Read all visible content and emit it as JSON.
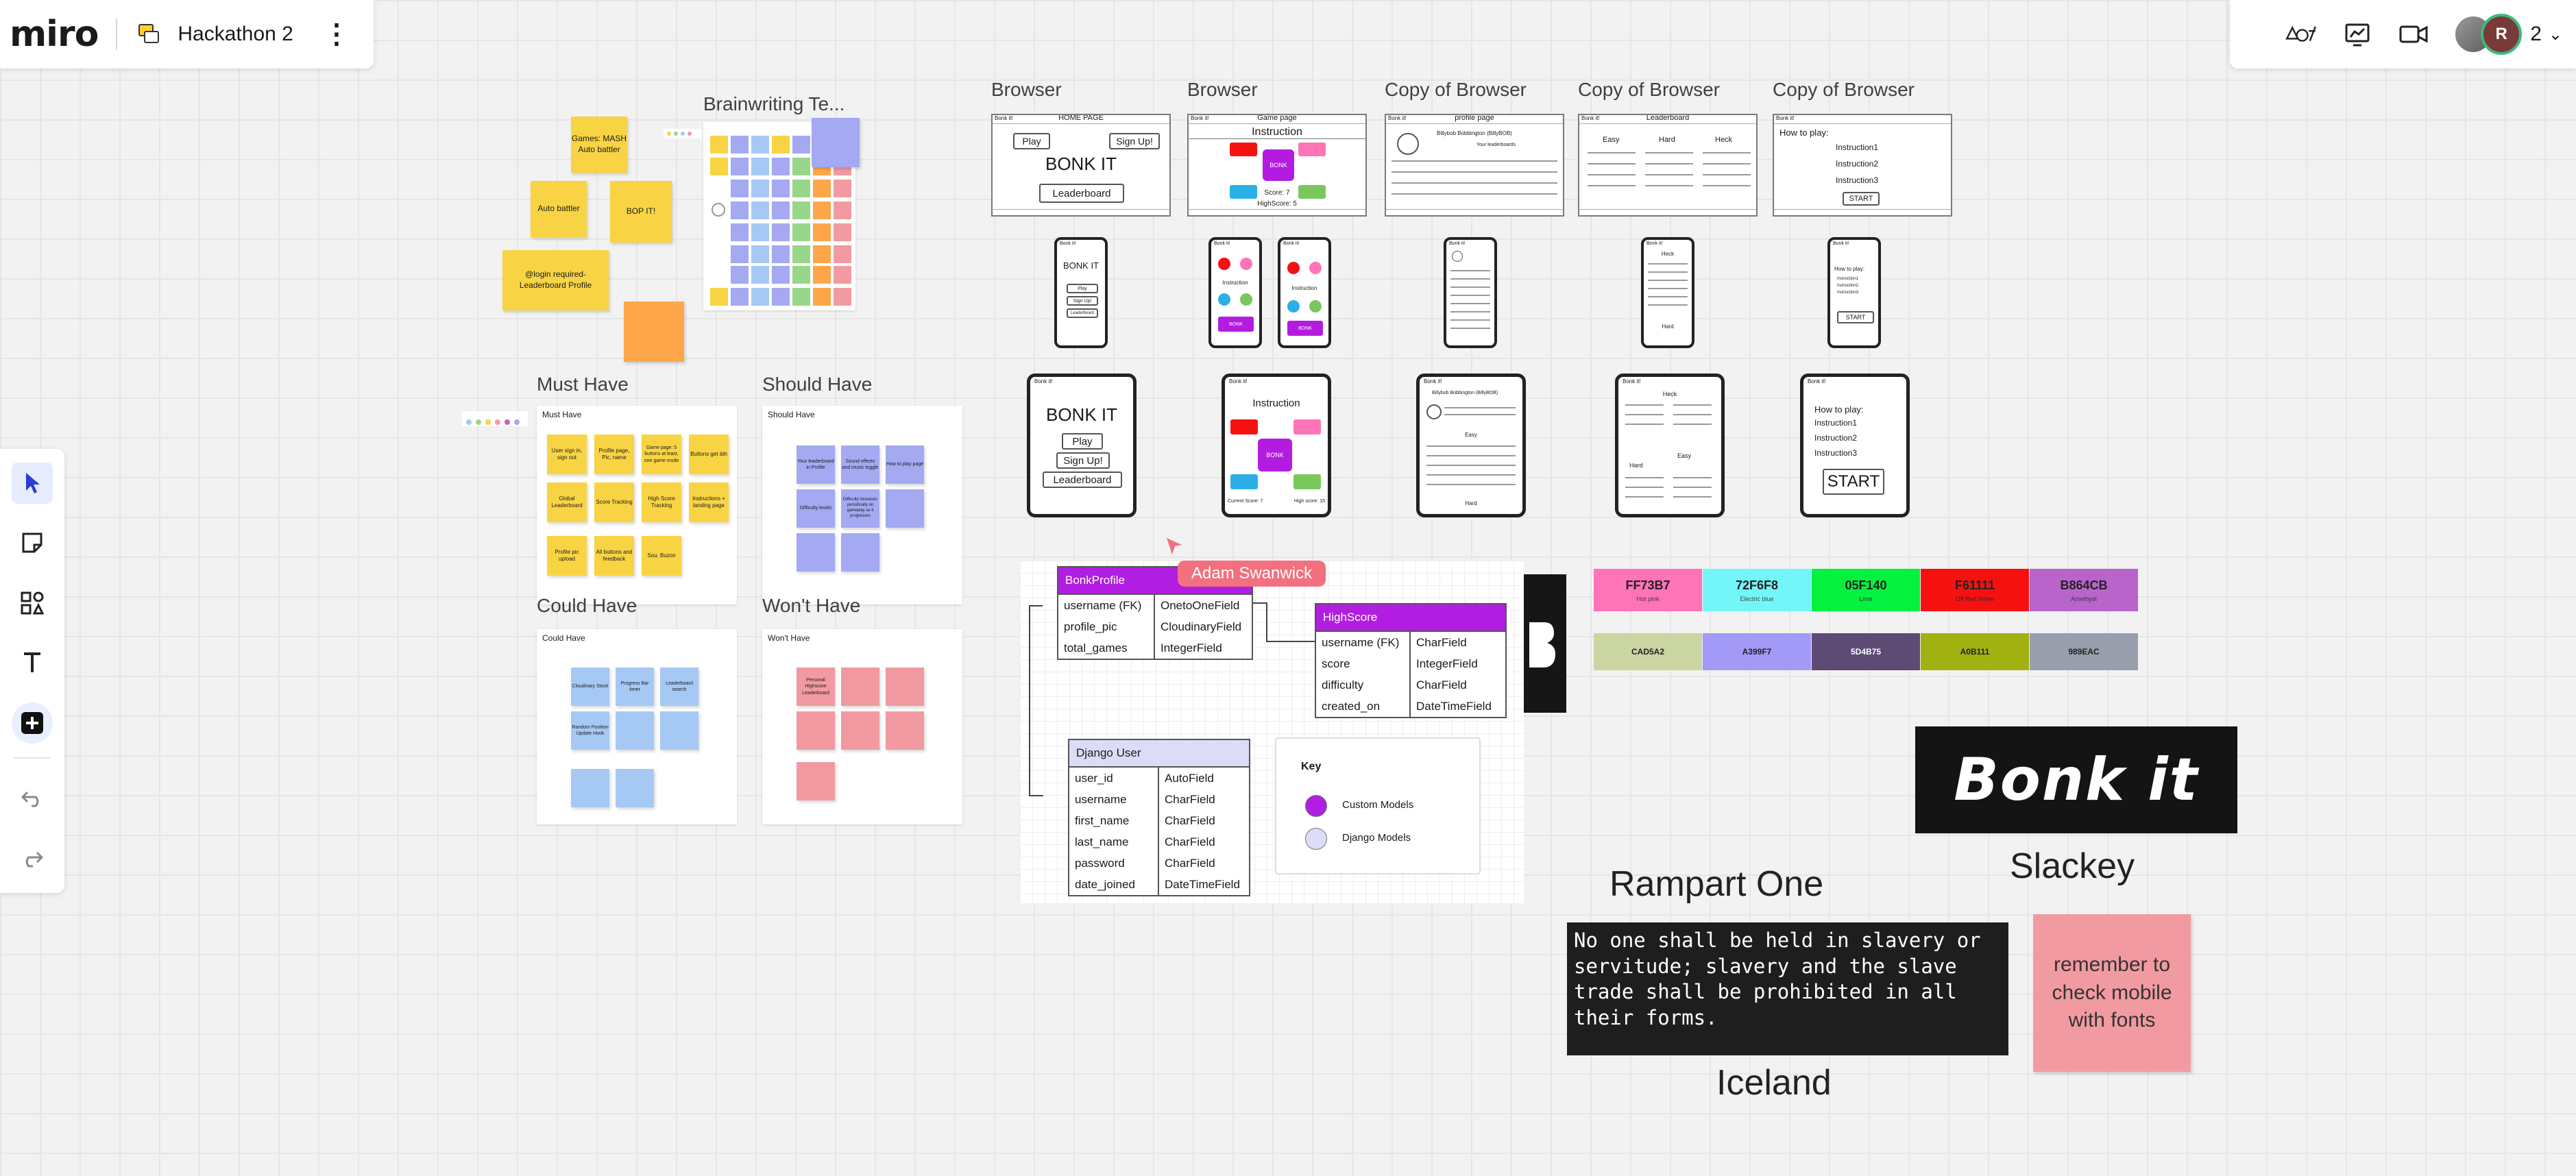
{
  "app": {
    "logo": "miro",
    "board_name": "Hackathon 2",
    "participants_count": "2",
    "avatar_initial": "R"
  },
  "brainstorm": {
    "title": "Brainwriting Te...",
    "notes": [
      "Games: MASH Auto battler",
      "Auto battler",
      "BOP IT!",
      "@login required- Leaderboard Profile"
    ]
  },
  "moscow": {
    "must": {
      "title": "Must Have",
      "inner": "Must Have",
      "notes": [
        "User sign in, sign out",
        "Profile page, Pic, name",
        "Game page: 5 buttons at least, one game mode",
        "Buttons get àth",
        "Global Leaderboard",
        "Score Tracking",
        "High Score Tracking",
        "Instructions + landing page",
        "Profile pic upload",
        "All buttons and feedback",
        "Sou. Buzon"
      ]
    },
    "should": {
      "title": "Should Have",
      "inner": "Should Have",
      "notes": [
        "Your leaderboard in Profile",
        "Sound effects and music toggle",
        "How to play page",
        "Difficulty levels",
        "Difficulty increases periodically on gameplay as it progresses"
      ]
    },
    "could": {
      "title": "Could Have",
      "inner": "Could Have",
      "notes": [
        "Cloudinary Stock",
        "Progress Bar timer",
        "Leaderboard search",
        "Random Position Update Hook"
      ]
    },
    "wont": {
      "title": "Won't Have",
      "inner": "Won't Have",
      "notes": [
        "Personal Highscore Leaderboard"
      ]
    }
  },
  "wireframes": {
    "titles": [
      "Browser",
      "Browser",
      "Copy of Browser",
      "Copy of Browser",
      "Copy of Browser"
    ],
    "subtitles": [
      "HOME PAGE",
      "Game page",
      "profile page",
      "Leaderboard",
      ""
    ],
    "app_name": "Bonk it!",
    "home": {
      "title": "BONK IT",
      "play": "Play",
      "signup": "Sign Up!",
      "leaderboard": "Leaderboard"
    },
    "game": {
      "instruction": "Instruction",
      "bonk": "BONK",
      "score": "Score: 7",
      "highscore": "HighScore: 5",
      "current_score": "Current Score: 7",
      "high_score": "High score: 15"
    },
    "profile": {
      "name": "Billybob Bobbington (BillyBOB)",
      "your_leaderboards": "Your leaderboards",
      "easy": "Easy",
      "hard": "Hard",
      "heck": "Heck"
    },
    "howto": {
      "heading": "How to play:",
      "steps": [
        "Instruction1",
        "Instruction2",
        "Instruction3"
      ],
      "start": "START"
    }
  },
  "erd": {
    "cursor_user": "Adam Swanwick",
    "bonkprofile": {
      "name": "BonkProfile",
      "rows": [
        [
          "username (FK)",
          "OnetoOneField"
        ],
        [
          "profile_pic",
          "CloudinaryField"
        ],
        [
          "total_games",
          "IntegerField"
        ]
      ]
    },
    "highscore": {
      "name": "HighScore",
      "rows": [
        [
          "username (FK)",
          "CharField"
        ],
        [
          "score",
          "IntegerField"
        ],
        [
          "difficulty",
          "CharField"
        ],
        [
          "created_on",
          "DateTimeField"
        ]
      ]
    },
    "django_user": {
      "name": "Django User",
      "rows": [
        [
          "user_id",
          "AutoField"
        ],
        [
          "username",
          "CharField"
        ],
        [
          "first_name",
          "CharField"
        ],
        [
          "last_name",
          "CharField"
        ],
        [
          "password",
          "CharField"
        ],
        [
          "date_joined",
          "DateTimeField"
        ]
      ]
    },
    "key": {
      "title": "Key",
      "custom": "Custom Models",
      "django": "Django Models"
    }
  },
  "palette": {
    "row1": [
      {
        "hex": "FF73B7",
        "name": "Hot pink",
        "color": "#FF73B7"
      },
      {
        "hex": "72F6F8",
        "name": "Electric blue",
        "color": "#72F6F8"
      },
      {
        "hex": "05F140",
        "name": "Lime",
        "color": "#05F140"
      },
      {
        "hex": "F61111",
        "name": "Off Red White",
        "color": "#F61111"
      },
      {
        "hex": "B864CB",
        "name": "Amethyst",
        "color": "#B864CB"
      }
    ],
    "row2": [
      {
        "hex": "CAD5A2",
        "color": "#CAD5A2"
      },
      {
        "hex": "A399F7",
        "color": "#A399F7"
      },
      {
        "hex": "5D4B75",
        "color": "#5D4B75"
      },
      {
        "hex": "A0B111",
        "color": "#A0B111"
      },
      {
        "hex": "989EAC",
        "color": "#989EAC"
      }
    ]
  },
  "fonts": {
    "logo_text": "Bonk it",
    "slackey": "Slackey",
    "rampart": "Rampart One",
    "iceland": "Iceland",
    "sample": "No one shall be held in slavery or servitude; slavery and the slave trade shall be prohibited in all their forms.",
    "reminder": "remember to check mobile with fonts"
  }
}
